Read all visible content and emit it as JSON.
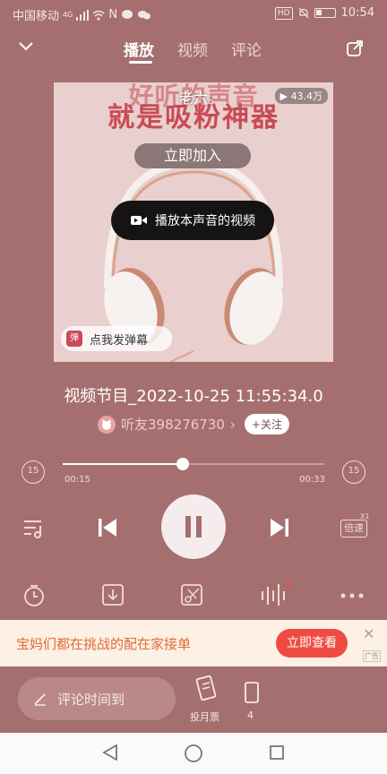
{
  "status_bar": {
    "carrier": "中国移动",
    "network": "4G",
    "extra": "N",
    "hd": "HD",
    "time": "10:54"
  },
  "header": {
    "tabs": [
      "播放",
      "视频",
      "评论"
    ],
    "active_tab": 0
  },
  "cover": {
    "title_line1": "好听的声音",
    "title_line2": "就是吸粉神器",
    "join_label": "立即加入",
    "overlay_text": "老六。",
    "play_count": "43.4万",
    "video_button_label": "播放本声音的视频",
    "danmaku_icon_text": "弹",
    "danmaku_label": "点我发弹幕"
  },
  "track": {
    "title": "视频节目_2022-10-25 11:55:34.0",
    "author": "听友398276730",
    "follow_label": "+关注"
  },
  "progress": {
    "current": "00:15",
    "total": "00:33",
    "fraction": 0.46,
    "skip_back": "15",
    "skip_forward": "15"
  },
  "controls": {
    "speed_label": "倍速",
    "speed_value": "X1"
  },
  "ad": {
    "text": "宝妈们都在挑战的配在家接单",
    "button": "立即查看",
    "tag": "广告"
  },
  "bottom": {
    "comment_placeholder": "评论时间到",
    "monthly_ticket": "投月票",
    "extra_label": "4"
  },
  "colors": {
    "background": "#a66f6f",
    "ad_accent": "#f04b43",
    "ad_text": "#e36a3a",
    "cover_title": "#c94b55"
  }
}
